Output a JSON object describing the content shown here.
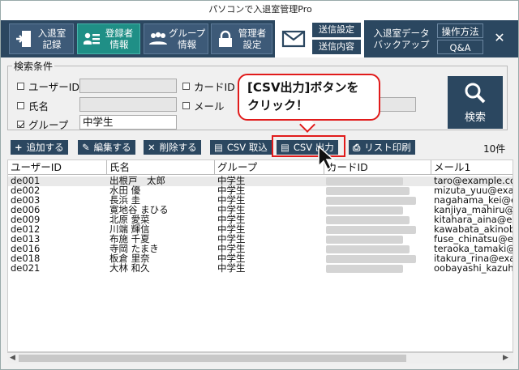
{
  "window": {
    "title": "パソコンで入退室管理Pro"
  },
  "nav": {
    "items": [
      {
        "label": "入退室\n記録",
        "icon": "door-exit-icon"
      },
      {
        "label": "登録者\n情報",
        "icon": "id-card-icon"
      },
      {
        "label": "グループ\n情報",
        "icon": "group-icon"
      },
      {
        "label": "管理者\n設定",
        "icon": "lock-icon"
      }
    ],
    "mail": {
      "icon": "envelope-icon",
      "send_settings": "送信設定",
      "send_content": "送信内容"
    },
    "backup": "入退室データ\nバックアップ",
    "howto": "操作方法",
    "qa": "Q&A",
    "close": "✕"
  },
  "filter": {
    "title": "検索条件",
    "user_id_label": "ユーザーID",
    "user_id_value": "",
    "card_id_label": "カードID",
    "name_label": "氏名",
    "mail_label": "メール",
    "group_label": "グループ",
    "group_value": "中学生",
    "group_checked": true,
    "search_label": "検索"
  },
  "callout": {
    "line1": "[CSV出力]ボタンを",
    "line2": "クリック！"
  },
  "toolbar": {
    "add": "追加する",
    "edit": "編集する",
    "delete": "削除する",
    "csv_import": "CSV 取込",
    "csv_export": "CSV 出力",
    "print_list": "リスト印刷",
    "count": "10件"
  },
  "table": {
    "columns": [
      "ユーザーID",
      "氏名",
      "グループ",
      "カードID",
      "メール1"
    ],
    "rows": [
      {
        "id": "de001",
        "name": "出根戸　太郎",
        "group": "中学生",
        "mail": "taro@example.com"
      },
      {
        "id": "de002",
        "name": "水田 優",
        "group": "中学生",
        "mail": "mizuta_yuu@exam"
      },
      {
        "id": "de003",
        "name": "長浜 圭",
        "group": "中学生",
        "mail": "nagahama_kei@ex"
      },
      {
        "id": "de006",
        "name": "寛地谷 まひる",
        "group": "中学生",
        "mail": "kanjiya_mahiru@e"
      },
      {
        "id": "de009",
        "name": "北原 愛菜",
        "group": "中学生",
        "mail": "kitahara_aina@exa"
      },
      {
        "id": "de012",
        "name": "川端 輝信",
        "group": "中学生",
        "mail": "kawabata_akinobu"
      },
      {
        "id": "de013",
        "name": "布施 千夏",
        "group": "中学生",
        "mail": "fuse_chinatsu@ex"
      },
      {
        "id": "de016",
        "name": "寺岡 たまき",
        "group": "中学生",
        "mail": "teraoka_tamaki@e"
      },
      {
        "id": "de018",
        "name": "板倉 里奈",
        "group": "中学生",
        "mail": "itakura_rina@exan"
      },
      {
        "id": "de021",
        "name": "大林 和久",
        "group": "中学生",
        "mail": "oobayashi_kazuhis"
      }
    ]
  },
  "colors": {
    "nav_bg": "#2b4760",
    "nav_active": "#1f8f86",
    "highlight": "#e11b1b"
  }
}
